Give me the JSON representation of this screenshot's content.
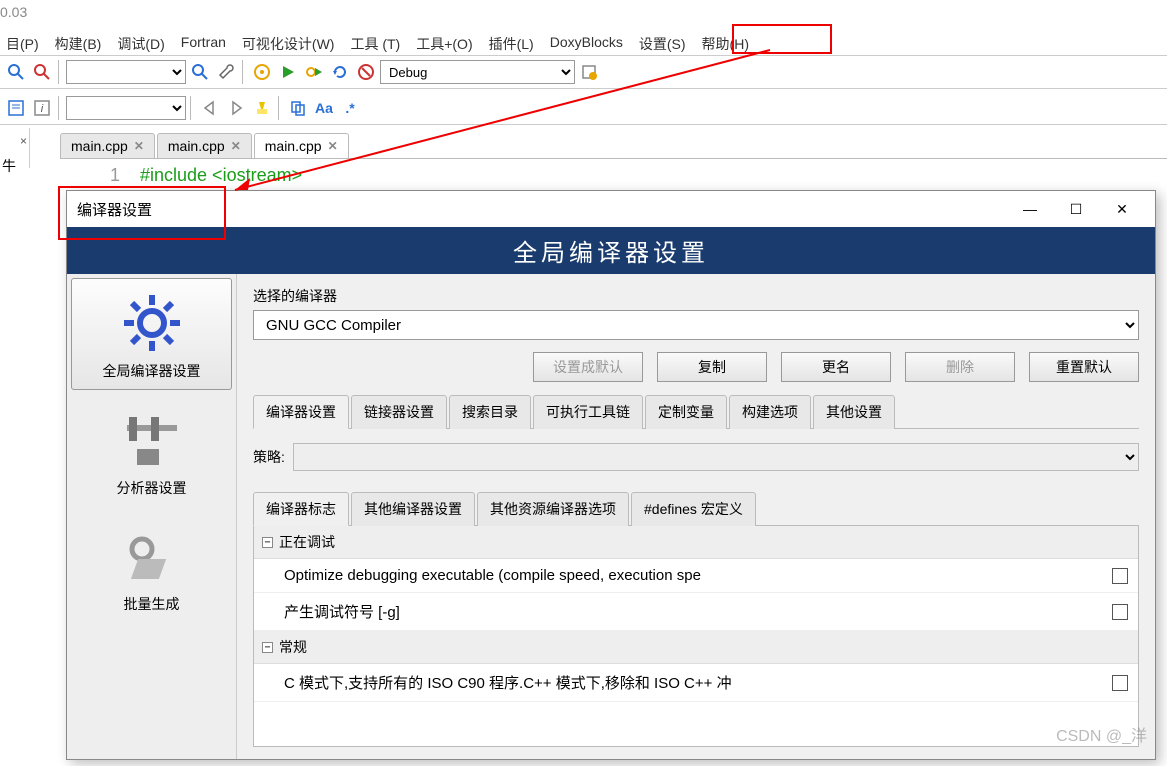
{
  "version": "0.03",
  "menu": [
    "目(P)",
    "构建(B)",
    "调试(D)",
    "Fortran",
    "可视化设计(W)",
    "工具 (T)",
    "工具+(O)",
    "插件(L)",
    "DoxyBlocks",
    "设置(S)",
    "帮助(H)"
  ],
  "toolbar1": {
    "build_target": "Debug"
  },
  "panel_left": {
    "close": "×",
    "label": "牛"
  },
  "file_tabs": [
    "main.cpp",
    "main.cpp",
    "main.cpp"
  ],
  "file_tabs_active": 2,
  "code": {
    "line_no": "1",
    "text": "#include <iostream>"
  },
  "dialog": {
    "title": "编译器设置",
    "banner": "全局编译器设置",
    "side": [
      "全局编译器设置",
      "分析器设置",
      "批量生成"
    ],
    "side_sel": 0,
    "compiler_label": "选择的编译器",
    "compiler_value": "GNU GCC Compiler",
    "buttons": [
      "设置成默认",
      "复制",
      "更名",
      "删除",
      "重置默认"
    ],
    "tabs_main": [
      "编译器设置",
      "链接器设置",
      "搜索目录",
      "可执行工具链",
      "定制变量",
      "构建选项",
      "其他设置"
    ],
    "tabs_main_act": 0,
    "policy_label": "策略:",
    "tabs_flags": [
      "编译器标志",
      "其他编译器设置",
      "其他资源编译器选项",
      "#defines 宏定义"
    ],
    "tabs_flags_act": 0,
    "groups": [
      {
        "name": "正在调试",
        "rows": [
          "Optimize debugging executable (compile speed, execution spe",
          "产生调试符号  [-g]"
        ]
      },
      {
        "name": "常规",
        "rows": [
          "C 模式下,支持所有的 ISO C90 程序.C++ 模式下,移除和 ISO C++ 冲"
        ]
      }
    ]
  },
  "watermark": "CSDN @_洋"
}
